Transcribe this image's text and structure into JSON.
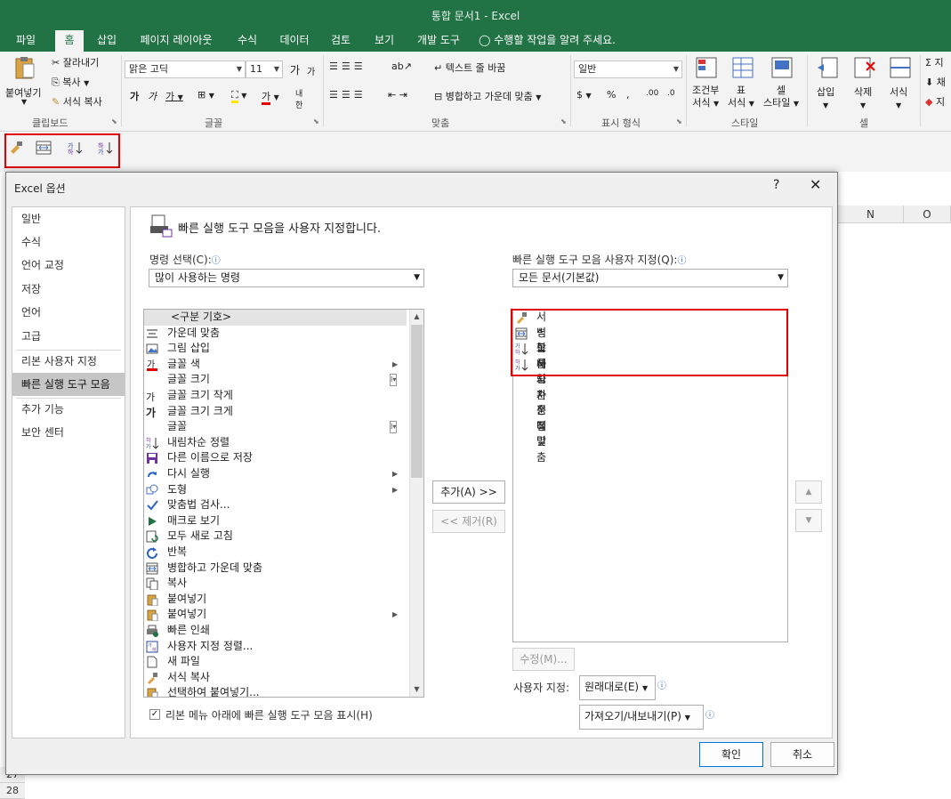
{
  "window": {
    "title": "통합 문서1 - Excel"
  },
  "ribbon_tabs": [
    "파일",
    "홈",
    "삽입",
    "페이지 레이아웃",
    "수식",
    "데이터",
    "검토",
    "보기",
    "개발 도구"
  ],
  "tell_me": "수행할 작업을 알려 주세요.",
  "ribbon": {
    "clipboard": {
      "paste": "붙여넣기",
      "cut": "잘라내기",
      "copy": "복사",
      "format_painter": "서식 복사",
      "label": "클립보드"
    },
    "font": {
      "name": "맑은 고딕",
      "size": "11",
      "grow": "가",
      "shrink": "가",
      "label": "글꼴"
    },
    "align": {
      "wrap": "텍스트 줄 바꿈",
      "merge": "병합하고 가운데 맞춤",
      "label": "맞춤"
    },
    "number": {
      "format": "일반",
      "label": "표시 형식"
    },
    "styles": {
      "cond1": "조건부",
      "cond2": "서식",
      "table1": "표",
      "table2": "서식",
      "cell1": "셀",
      "cell2": "스타일",
      "label": "스타일"
    },
    "cells": {
      "insert": "삽입",
      "delete": "삭제",
      "format": "서식",
      "label": "셀"
    },
    "editing": {
      "e1": "지",
      "e2": "채",
      "e3": "지"
    }
  },
  "sheet": {
    "columns": [
      "N",
      "O"
    ],
    "rows": [
      "27",
      "28"
    ]
  },
  "dialog": {
    "title": "Excel 옵션",
    "help": "?",
    "close": "✕",
    "nav": [
      "일반",
      "수식",
      "언어 교정",
      "저장",
      "언어",
      "고급",
      "리본 사용자 지정",
      "빠른 실행 도구 모음",
      "추가 기능",
      "보안 센터"
    ],
    "selected_nav": "빠른 실행 도구 모음",
    "heading": "빠른 실행 도구 모음을 사용자 지정합니다.",
    "choose_label": "명령 선택(C):",
    "choose_value": "많이 사용하는 명령",
    "custom_label": "빠른 실행 도구 모음 사용자 지정(Q):",
    "custom_value": "모든 문서(기본값)",
    "commands": [
      {
        "text": "<구분 기호>",
        "icon": "none"
      },
      {
        "text": "가운데 맞춤",
        "icon": "center"
      },
      {
        "text": "그림 삽입",
        "icon": "picture"
      },
      {
        "text": "글꼴 색",
        "icon": "fontcolor",
        "sub": "▶"
      },
      {
        "text": "글꼴 크기",
        "icon": "none",
        "sub": "combo"
      },
      {
        "text": "글꼴 크기 작게",
        "icon": "shrink"
      },
      {
        "text": "글꼴 크기 크게",
        "icon": "grow"
      },
      {
        "text": "글꼴",
        "icon": "none",
        "sub": "combo"
      },
      {
        "text": "내림차순 정렬",
        "icon": "sortdesc"
      },
      {
        "text": "다른 이름으로 저장",
        "icon": "saveas"
      },
      {
        "text": "다시 실행",
        "icon": "redo",
        "sub": "▶"
      },
      {
        "text": "도형",
        "icon": "shape",
        "sub": "▶"
      },
      {
        "text": "맞춤법 검사...",
        "icon": "spell"
      },
      {
        "text": "매크로 보기",
        "icon": "macro"
      },
      {
        "text": "모두 새로 고침",
        "icon": "refresh"
      },
      {
        "text": "반복",
        "icon": "repeat"
      },
      {
        "text": "병합하고 가운데 맞춤",
        "icon": "merge"
      },
      {
        "text": "복사",
        "icon": "copy"
      },
      {
        "text": "붙여넣기",
        "icon": "paste"
      },
      {
        "text": "붙여넣기",
        "icon": "paste",
        "sub": "▶"
      },
      {
        "text": "빠른 인쇄",
        "icon": "print"
      },
      {
        "text": "사용자 지정 정렬...",
        "icon": "customsort"
      },
      {
        "text": "새 파일",
        "icon": "newfile"
      },
      {
        "text": "서식 복사",
        "icon": "painter"
      },
      {
        "text": "선택하여 붙여넣기...",
        "icon": "paste"
      }
    ],
    "qat_items": [
      {
        "text": "서식 복사",
        "icon": "painter"
      },
      {
        "text": "병합하고 가운데 맞춤",
        "icon": "merge"
      },
      {
        "text": "오름차순 정렬",
        "icon": "sortasc"
      },
      {
        "text": "내림차순 정렬",
        "icon": "sortdesc"
      }
    ],
    "add_button": "추가(A) >>",
    "remove_button": "<< 제거(R)",
    "modify_button": "수정(M)...",
    "customize_label": "사용자 지정:",
    "reset_button": "원래대로(E)",
    "import_button": "가져오기/내보내기(P)",
    "show_below_label": "리본 메뉴 아래에 빠른 실행 도구 모음 표시(H)",
    "show_below_checked": true,
    "ok_button": "확인",
    "cancel_button": "취소"
  }
}
